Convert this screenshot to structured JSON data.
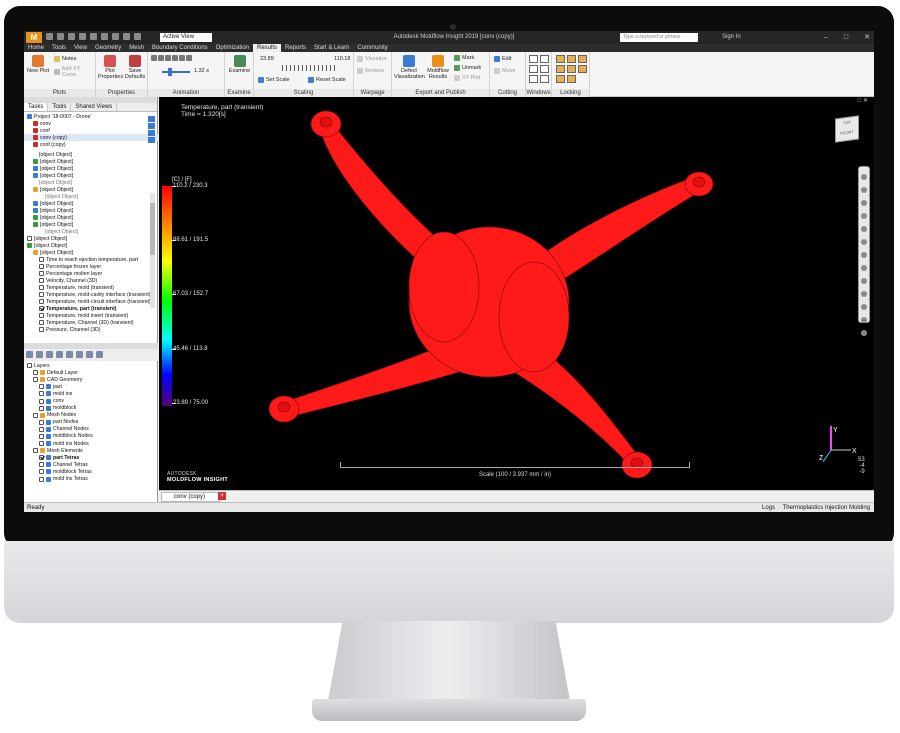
{
  "app": {
    "window_title": "Autodesk Moldflow Insight 2019   [conv (copy)]",
    "logo": "M",
    "active_view": "Active View",
    "search_placeholder": "Type a keyword or phrase",
    "sign_in": "Sign In"
  },
  "menu": [
    "Home",
    "Tools",
    "View",
    "Geometry",
    "Mesh",
    "Boundary Conditions",
    "Optimization",
    "Results",
    "Reports",
    "Start & Learn",
    "Community"
  ],
  "menu_active": "Results",
  "ribbon": {
    "groups": [
      "Plots",
      "Properties",
      "Animation",
      "Examine",
      "Scaling",
      "Warpage",
      "Export and Publish",
      "Cutting Plane",
      "Windows",
      "Locking"
    ],
    "new_plot": "New Plot",
    "notes": "Notes",
    "add_xy_curve": "Add XY Curve",
    "plot_properties": "Plot Properties",
    "save_defaults": "Save Defaults",
    "anim_time": "1.32 s",
    "examine": "Examine",
    "scale_min": "23.89",
    "scale_max": "110.18",
    "set_scale": "Set Scale",
    "reset_scale": "Reset Scale",
    "visualize": "Visualize",
    "restore": "Restore",
    "defect_visualization": "Defect Visualization",
    "moldflow_results": "Moldflow Results",
    "mark": "Mark",
    "unmark": "Unmark",
    "xy_plot": "XY Plot",
    "edit": "Edit",
    "move": "Move"
  },
  "left_panel": {
    "tabs": [
      "Tasks",
      "Tools",
      "Shared Views"
    ],
    "project": "Project '18-0007 - Drone'",
    "studies": [
      "conv",
      "conf",
      "conv (copy)",
      "conf (copy)"
    ],
    "tasks": [
      {
        "label": "Environmental Properties",
        "indent": 2,
        "icon": "none"
      },
      {
        "label": "1 Injection Location(s)",
        "indent": 1,
        "icon": "green"
      },
      {
        "label": "Cooling Circuit(s)",
        "indent": 1,
        "icon": "blue"
      },
      {
        "label": "Coolant Inlets/Outlets",
        "indent": 1,
        "icon": "blue"
      },
      {
        "label": "Channel(s) (3D) with 2 inlet(s) and 2 outlet(s)",
        "indent": 2,
        "icon": "none",
        "grey": true
      },
      {
        "label": "2 Mold Component(s)",
        "indent": 1,
        "icon": "orange"
      },
      {
        "label": "2 CAD Mold Component(s)",
        "indent": 3,
        "icon": "none",
        "grey": true
      },
      {
        "label": "3D Channel Mesh (783773 elements)",
        "indent": 1,
        "icon": "blue"
      },
      {
        "label": "Mold 3D Mesh (953766 elements)",
        "indent": 1,
        "icon": "blue"
      },
      {
        "label": "Process Settings (User)",
        "indent": 1,
        "icon": "green"
      },
      {
        "label": "Optimization (None)",
        "indent": 1,
        "icon": "green"
      },
      {
        "label": "Analysis complete",
        "indent": 3,
        "icon": "none",
        "grey": true
      },
      {
        "label": "Logs",
        "indent": 0,
        "icon": "box"
      },
      {
        "label": "Results",
        "indent": 0,
        "icon": "green"
      },
      {
        "label": "Cool",
        "indent": 1,
        "icon": "orange"
      }
    ],
    "results": [
      "Time to reach ejection temperature, part",
      "Percentage frozen layer",
      "Percentage molten layer",
      "Velocity, Channel (3D)",
      "Temperature, mold (transient)",
      "Temperature, mold-cavity interface (transient)",
      "Temperature, mold-circuit interface (transient)",
      "Temperature, part (transient)",
      "Temperature, mold insert (transient)",
      "Temperature, Channel (3D) (transient)",
      "Pressure, Channel (3D)"
    ],
    "result_selected_index": 7
  },
  "layers": {
    "title": "Layers",
    "items": [
      {
        "label": "Default Layer",
        "indent": 1,
        "checked": false,
        "folder": true
      },
      {
        "label": "CAD Geometry",
        "indent": 1,
        "checked": false,
        "folder": true
      },
      {
        "label": "part",
        "indent": 2,
        "checked": false
      },
      {
        "label": "mold ins",
        "indent": 2,
        "checked": false
      },
      {
        "label": "conv",
        "indent": 2,
        "checked": false
      },
      {
        "label": "moldblock",
        "indent": 2,
        "checked": false
      },
      {
        "label": "Mesh Nodes",
        "indent": 1,
        "checked": false,
        "folder": true
      },
      {
        "label": "part Nodes",
        "indent": 2,
        "checked": false
      },
      {
        "label": "Channel Nodes",
        "indent": 2,
        "checked": false
      },
      {
        "label": "moldblock Nodes",
        "indent": 2,
        "checked": false
      },
      {
        "label": "mold ins Nodes",
        "indent": 2,
        "checked": false
      },
      {
        "label": "Mesh Elements",
        "indent": 1,
        "checked": false,
        "folder": true
      },
      {
        "label": "part Tetras",
        "indent": 2,
        "checked": true,
        "bold": true
      },
      {
        "label": "Channel Tetras",
        "indent": 2,
        "checked": false
      },
      {
        "label": "moldblock Tetras",
        "indent": 2,
        "checked": false
      },
      {
        "label": "mold ins Tetras",
        "indent": 2,
        "checked": false
      }
    ]
  },
  "viewport": {
    "result_title": "Temperature, part (transient)",
    "time_label": "Time = 1.320[s]",
    "legend_unit": "[C] / [F]",
    "legend_labels": [
      "110.2 / 230.3",
      "88.61 / 191.5",
      "67.03 / 152.7",
      "45.46 / 113.8",
      "23.89 / 75.00"
    ],
    "brand_line1": "AUTODESK",
    "brand_line2": "MOLDFLOW INSIGHT",
    "scale_text": "Scale (100 / 3.937 mm / in)",
    "view_cube": "TOP FRONT",
    "triad_numbers": "53\n-4\n-9",
    "part_color": "#ff1a1a"
  },
  "doc_tab": "conv (copy)",
  "status": {
    "left": "Ready",
    "logs": "Logs",
    "module": "Thermoplastics Injection Molding"
  }
}
